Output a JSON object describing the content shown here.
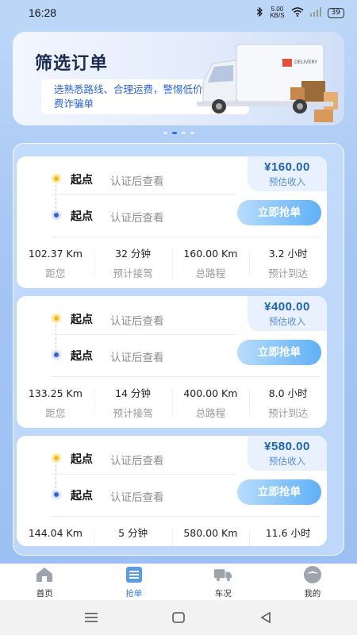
{
  "status_bar": {
    "time": "16:28",
    "network_speed": "5.00",
    "network_unit": "KB/S",
    "battery": "39"
  },
  "banner": {
    "title": "筛选订单",
    "description": "选熟悉路线、合理运费，警惕低价单或高运费诈骗单",
    "truck_text": "DELIVERY",
    "page_count": 4,
    "active_page": 1
  },
  "orders": [
    {
      "price": "¥160.00",
      "price_label": "预估收入",
      "start_label": "起点",
      "start_value": "认证后查看",
      "end_label": "起点",
      "end_value": "认证后查看",
      "button_label": "立即抢单",
      "stats": [
        {
          "value": "102.37 Km",
          "label": "距您"
        },
        {
          "value": "32 分钟",
          "label": "预计接驾"
        },
        {
          "value": "160.00 Km",
          "label": "总路程"
        },
        {
          "value": "3.2 小时",
          "label": "预计到达"
        }
      ]
    },
    {
      "price": "¥400.00",
      "price_label": "预估收入",
      "start_label": "起点",
      "start_value": "认证后查看",
      "end_label": "起点",
      "end_value": "认证后查看",
      "button_label": "立即抢单",
      "stats": [
        {
          "value": "133.25 Km",
          "label": "距您"
        },
        {
          "value": "14 分钟",
          "label": "预计接驾"
        },
        {
          "value": "400.00 Km",
          "label": "总路程"
        },
        {
          "value": "8.0 小时",
          "label": "预计到达"
        }
      ]
    },
    {
      "price": "¥580.00",
      "price_label": "预估收入",
      "start_label": "起点",
      "start_value": "认证后查看",
      "end_label": "起点",
      "end_value": "认证后查看",
      "button_label": "立即抢单",
      "stats": [
        {
          "value": "144.04 Km",
          "label": ""
        },
        {
          "value": "5 分钟",
          "label": ""
        },
        {
          "value": "580.00 Km",
          "label": ""
        },
        {
          "value": "11.6 小时",
          "label": ""
        }
      ]
    }
  ],
  "tabbar": {
    "items": [
      {
        "label": "首页",
        "icon": "home-icon"
      },
      {
        "label": "抢单",
        "icon": "list-icon"
      },
      {
        "label": "车况",
        "icon": "truck-icon"
      },
      {
        "label": "我的",
        "icon": "profile-icon"
      }
    ],
    "active_index": 1,
    "active_color": "#3a7fe0"
  },
  "system_nav": {
    "icons": [
      "menu-icon",
      "home-square-icon",
      "back-icon"
    ]
  }
}
